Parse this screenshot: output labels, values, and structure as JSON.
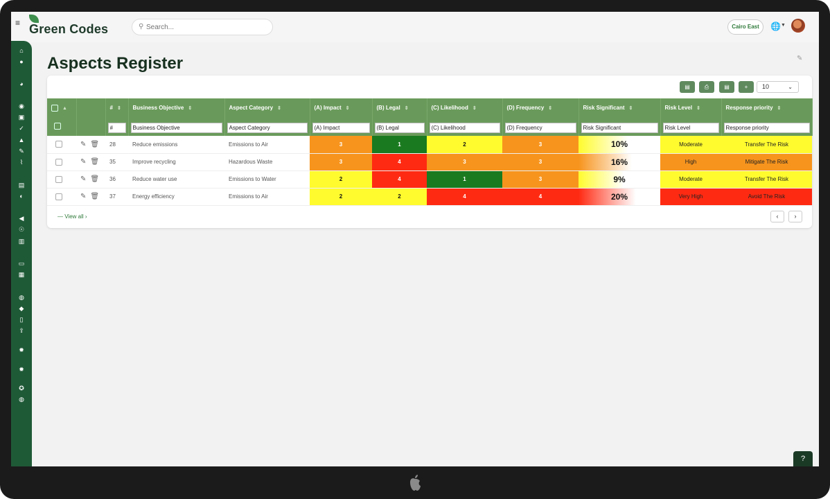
{
  "app": {
    "logo_text": "Green Codes",
    "search_placeholder": "Search...",
    "site_label": "Cairo East"
  },
  "page": {
    "title": "Aspects Register"
  },
  "toolbar": {
    "page_size": "10"
  },
  "table": {
    "columns": [
      "#",
      "Business Objective",
      "Aspect Category",
      "(A) Impact",
      "(B) Legal",
      "(C) Likelihood",
      "(D) Frequency",
      "Risk Significant",
      "Risk Level",
      "Response priority"
    ],
    "filters": [
      "#",
      "Business Objective",
      "Aspect Category",
      "(A) Impact",
      "(B) Legal",
      "(C) Likelihood",
      "(D) Frequency",
      "Risk Significant",
      "Risk Level",
      "Response priority"
    ],
    "rows": [
      {
        "id": "28",
        "objective": "Reduce emissions",
        "category": "Emissions to Air",
        "impact": "3",
        "legal": "1",
        "likelihood": "2",
        "frequency": "3",
        "risk": "10%",
        "level": "Moderate",
        "response": "Transfer The Risk"
      },
      {
        "id": "35",
        "objective": "Improve recycling",
        "category": "Hazardous Waste",
        "impact": "3",
        "legal": "4",
        "likelihood": "3",
        "frequency": "3",
        "risk": "16%",
        "level": "High",
        "response": "Mitigate The Risk"
      },
      {
        "id": "36",
        "objective": "Reduce water use",
        "category": "Emissions to Water",
        "impact": "2",
        "legal": "4",
        "likelihood": "1",
        "frequency": "3",
        "risk": "9%",
        "level": "Moderate",
        "response": "Transfer The Risk"
      },
      {
        "id": "37",
        "objective": "Energy efficiency",
        "category": "Emissions to Air",
        "impact": "2",
        "legal": "2",
        "likelihood": "4",
        "frequency": "4",
        "risk": "20%",
        "level": "Very High",
        "response": "Avoid The Risk"
      }
    ]
  },
  "footer": {
    "view_all": "— View all ›"
  },
  "colors": {
    "brand_green": "#1f5a37",
    "header_green": "#6a9a5b",
    "orange": "#f7941d",
    "yellow": "#fffb2e",
    "red": "#ff2a12",
    "dark_green": "#1a7a1f"
  }
}
